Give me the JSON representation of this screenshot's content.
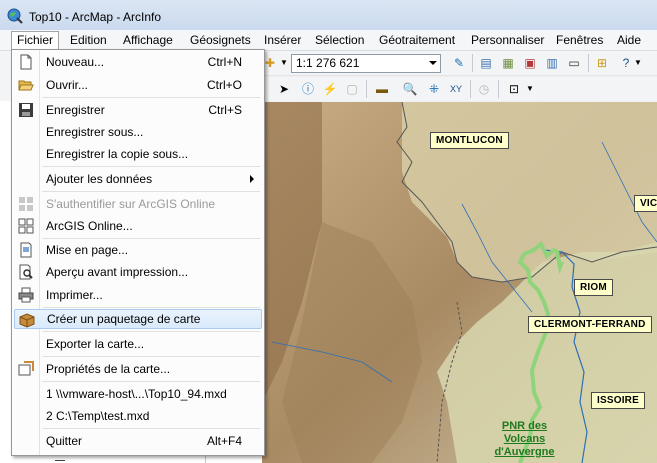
{
  "window": {
    "title": "Top10 - ArcMap - ArcInfo"
  },
  "menubar": [
    "Fichier",
    "Edition",
    "Affichage",
    "Géosignets",
    "Insérer",
    "Sélection",
    "Géotraitement",
    "Personnaliser",
    "Fenêtres",
    "Aide"
  ],
  "toolbar": {
    "scale_value": "1:1 276 621"
  },
  "file_menu": {
    "items": [
      {
        "label": "Nouveau...",
        "shortcut": "Ctrl+N",
        "icon": "new-document-icon"
      },
      {
        "label": "Ouvrir...",
        "shortcut": "Ctrl+O",
        "icon": "open-folder-icon"
      },
      {
        "label": "Enregistrer",
        "shortcut": "Ctrl+S",
        "icon": "save-icon"
      },
      {
        "label": "Enregistrer sous...",
        "shortcut": ""
      },
      {
        "label": "Enregistrer la copie sous...",
        "shortcut": ""
      },
      {
        "label": "Ajouter les données",
        "shortcut": "",
        "submenu": true
      },
      {
        "label": "S'authentifier sur ArcGIS Online",
        "shortcut": "",
        "disabled": true,
        "icon": "arcgis-online-sign-in-icon"
      },
      {
        "label": "ArcGIS Online...",
        "shortcut": "",
        "icon": "arcgis-online-icon"
      },
      {
        "label": "Mise en page...",
        "shortcut": "",
        "icon": "page-setup-icon"
      },
      {
        "label": "Aperçu avant impression...",
        "shortcut": "",
        "icon": "print-preview-icon"
      },
      {
        "label": "Imprimer...",
        "shortcut": "",
        "icon": "print-icon"
      },
      {
        "label": "Créer un paquetage de carte",
        "shortcut": "",
        "icon": "map-package-icon",
        "highlighted": true
      },
      {
        "label": "Exporter la carte...",
        "shortcut": ""
      },
      {
        "label": "Propriétés de la carte...",
        "shortcut": "",
        "icon": "map-properties-icon"
      },
      {
        "label": "1 \\\\vmware-host\\...\\Top10_94.mxd",
        "shortcut": ""
      },
      {
        "label": "2 C:\\Temp\\test.mxd",
        "shortcut": ""
      },
      {
        "label": "Quitter",
        "shortcut": "Alt+F4"
      }
    ]
  },
  "map_labels": [
    "MONTLUCON",
    "VIC",
    "RIOM",
    "CLERMONT-FERRAND",
    "ISSOIRE"
  ],
  "pnr_label": [
    "PNR des",
    "Volcans",
    "d'Auvergne"
  ],
  "colors": {
    "highlight": "#d9eafc",
    "label_bg": "#ffffcc",
    "park_border": "#8fd47a",
    "terrain": "#b89c79"
  }
}
